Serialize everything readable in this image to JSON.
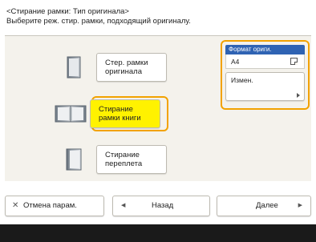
{
  "header": {
    "title": "<Стирание рамки: Тип оригинала>",
    "instruction": "Выберите реж. стир. рамки, подходящий оригиналу."
  },
  "options": [
    {
      "label_line1": "Стер. рамки",
      "label_line2": "оригинала",
      "icon": "original-page-icon",
      "selected": false
    },
    {
      "label_line1": "Стирание",
      "label_line2": "рамки книги",
      "icon": "book-icon",
      "selected": true
    },
    {
      "label_line1": "Стирание",
      "label_line2": "переплета",
      "icon": "binding-icon",
      "selected": false
    }
  ],
  "format_panel": {
    "title": "Формат ориги.",
    "value": "A4",
    "change_label": "Измен."
  },
  "footer": {
    "cancel_label": "Отмена парам.",
    "back_label": "Назад",
    "next_label": "Далее"
  },
  "colors": {
    "accent_orange": "#f2a200",
    "selected_yellow": "#fff200",
    "panel_blue": "#2f63b3"
  }
}
